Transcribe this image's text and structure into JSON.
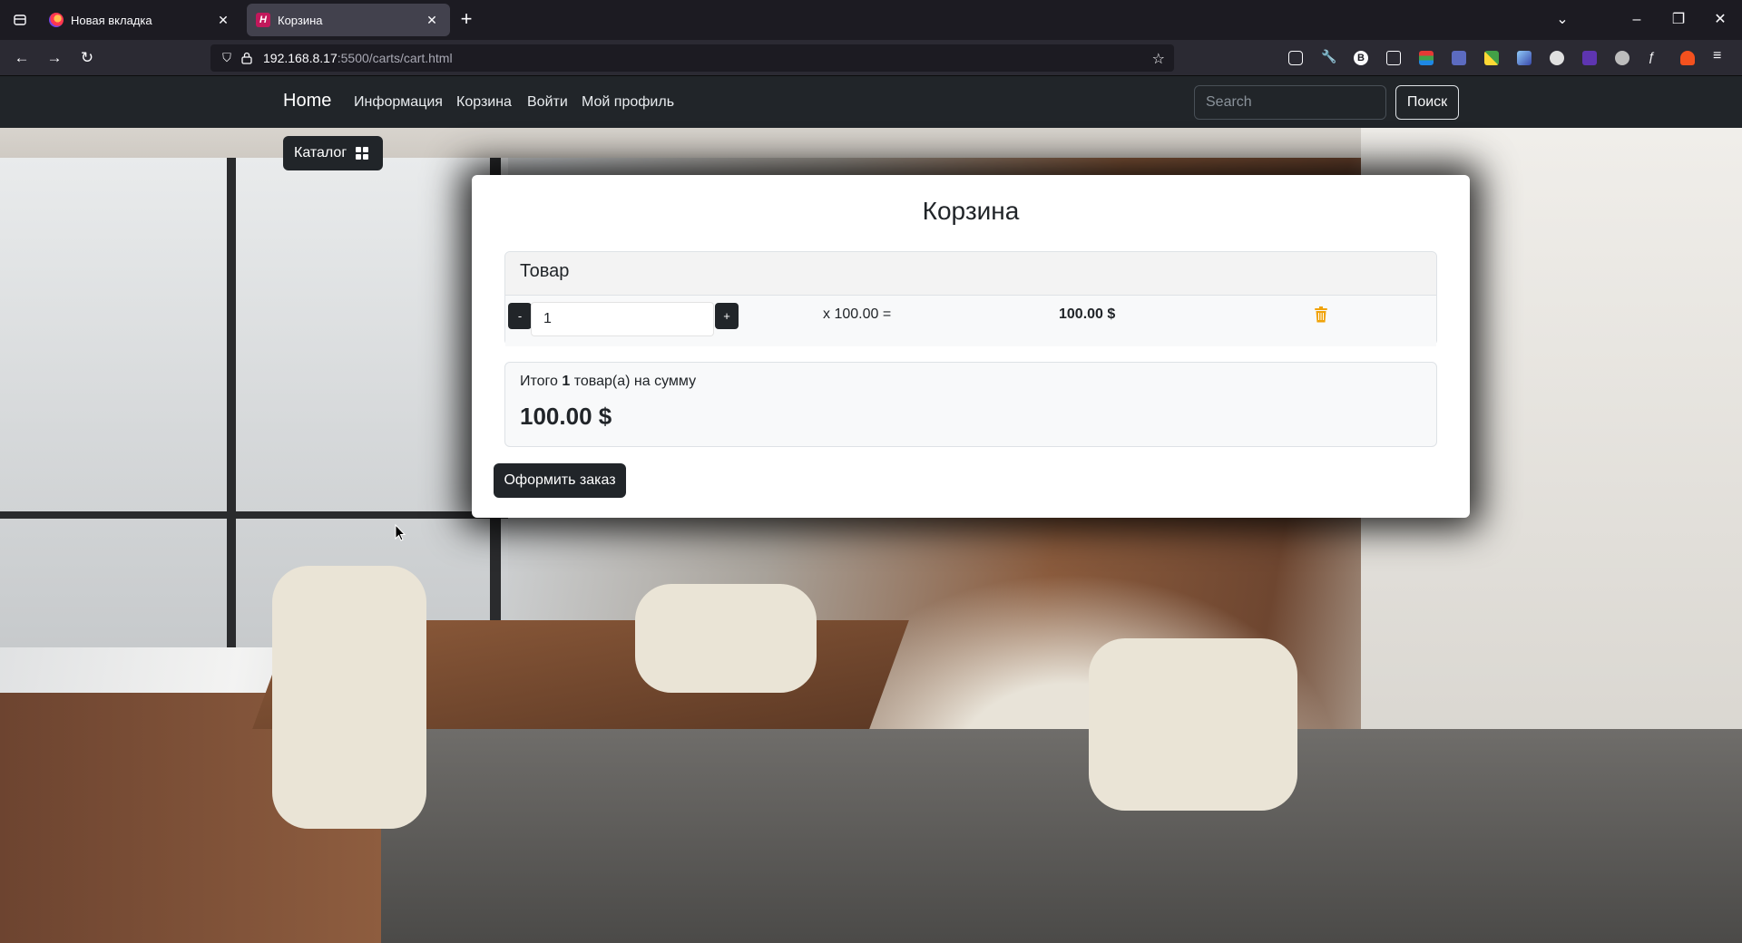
{
  "browser": {
    "tabs": [
      {
        "title": "Новая вкладка",
        "active": false
      },
      {
        "title": "Корзина",
        "active": true
      }
    ],
    "url_host": "192.168.8.17",
    "url_path": ":5500/carts/cart.html"
  },
  "site_nav": {
    "brand": "Home",
    "links": [
      "Информация",
      "Корзина",
      "Войти",
      "Мой профиль"
    ],
    "search_placeholder": "Search",
    "search_button": "Поиск"
  },
  "catalog": {
    "label": "Каталог"
  },
  "cart": {
    "title": "Корзина",
    "items_header": "Товар",
    "item": {
      "minus_label": "-",
      "plus_label": "+",
      "quantity": "1",
      "price_text": "x 100.00 =",
      "sum_text": "100.00 $"
    },
    "total_prefix": "Итого",
    "total_count": "1",
    "total_suffix": "товар(а) на сумму",
    "total_sum": "100.00 $",
    "order_button": "Оформить заказ"
  },
  "colors": {
    "navbar": "#212529",
    "trash_icon": "#f0a30a"
  }
}
